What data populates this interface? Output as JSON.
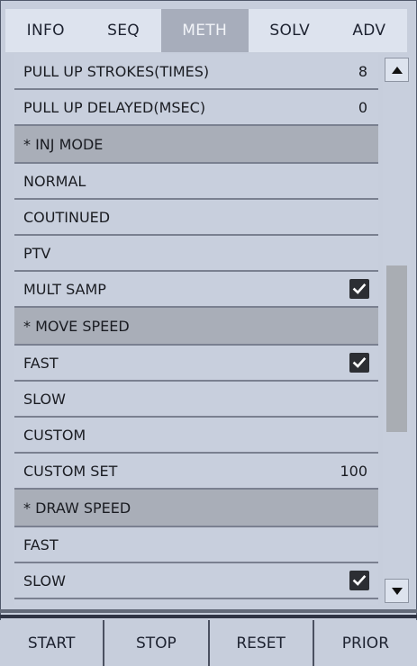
{
  "tabs": [
    {
      "label": "INFO",
      "active": false
    },
    {
      "label": "SEQ",
      "active": false
    },
    {
      "label": "METH",
      "active": true
    },
    {
      "label": "SOLV",
      "active": false
    },
    {
      "label": "ADV",
      "active": false
    }
  ],
  "rows": [
    {
      "label": "PULL UP STROKES(TIMES)",
      "value": "8",
      "type": "value"
    },
    {
      "label": "PULL UP DELAYED(MSEC)",
      "value": "0",
      "type": "value"
    },
    {
      "label": "* INJ MODE",
      "type": "section"
    },
    {
      "label": "NORMAL",
      "type": "option",
      "checked": false
    },
    {
      "label": "COUTINUED",
      "type": "option",
      "checked": false
    },
    {
      "label": "PTV",
      "type": "option",
      "checked": false
    },
    {
      "label": "MULT SAMP",
      "type": "option",
      "checked": true
    },
    {
      "label": "* MOVE SPEED",
      "type": "section"
    },
    {
      "label": "FAST",
      "type": "option",
      "checked": true
    },
    {
      "label": "SLOW",
      "type": "option",
      "checked": false
    },
    {
      "label": "CUSTOM",
      "type": "option",
      "checked": false
    },
    {
      "label": "CUSTOM SET",
      "value": "100",
      "type": "value"
    },
    {
      "label": "* DRAW SPEED",
      "type": "section"
    },
    {
      "label": "FAST",
      "type": "option",
      "checked": false
    },
    {
      "label": "SLOW",
      "type": "option",
      "checked": true
    }
  ],
  "scrollbar": {
    "thumb_start_fraction": 0.37,
    "thumb_length_fraction": 0.34,
    "up_icon": "triangle-up-icon",
    "down_icon": "triangle-down-icon"
  },
  "bottom_buttons": [
    "START",
    "STOP",
    "RESET",
    "PRIOR"
  ],
  "colors": {
    "active_tab": "#a7adbb",
    "section_bg": "#a9aeb8",
    "panel_bg": "#c8cfdd",
    "checkbox": "#2c2e33"
  }
}
